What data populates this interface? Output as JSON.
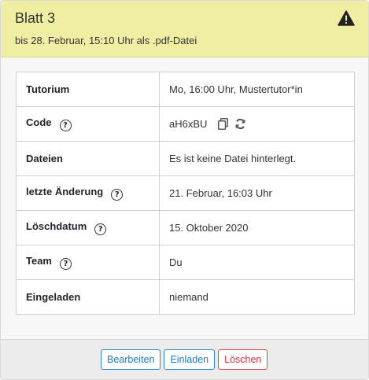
{
  "header": {
    "title": "Blatt 3",
    "subtitle": "bis 28. Februar, 15:10 Uhr als .pdf-Datei",
    "warning_icon": "warning-triangle-icon"
  },
  "rows": [
    {
      "label": "Tutorium",
      "value": "Mo, 16:00 Uhr, Mustertutor*in",
      "help": false
    },
    {
      "label": "Code",
      "value": "aH6xBU",
      "help": true
    },
    {
      "label": "Dateien",
      "value": "Es ist keine Datei hinterlegt.",
      "help": false
    },
    {
      "label": "letzte Änderung",
      "value": "21. Februar, 16:03 Uhr",
      "help": true
    },
    {
      "label": "Löschdatum",
      "value": "15. Oktober 2020",
      "help": true
    },
    {
      "label": "Team",
      "value": "Du",
      "help": true
    },
    {
      "label": "Eingeladen",
      "value": "niemand",
      "help": false
    }
  ],
  "help_glyph": "?",
  "code_icons": [
    "copy-icon",
    "refresh-icon"
  ],
  "footer": {
    "edit_label": "Bearbeiten",
    "invite_label": "Einladen",
    "delete_label": "Löschen"
  },
  "colors": {
    "header_bg": "#f0eea3",
    "primary": "#1a7fd1",
    "danger": "#d9343f"
  }
}
